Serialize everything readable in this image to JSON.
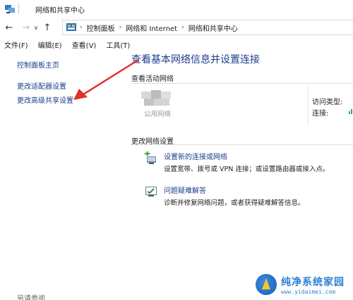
{
  "window": {
    "title": "网络和共享中心"
  },
  "navigation": {
    "breadcrumbs": [
      "控制面板",
      "网络和 Internet",
      "网络和共享中心"
    ]
  },
  "menu": {
    "items": [
      "文件(F)",
      "编辑(E)",
      "查看(V)",
      "工具(T)"
    ]
  },
  "sidebar": {
    "links": [
      "控制面板主页",
      "更改适配器设置",
      "更改高级共享设置"
    ],
    "see_also": "另请参阅"
  },
  "main": {
    "title": "查看基本网络信息并设置连接",
    "active_networks_label": "查看活动网络",
    "network_name": "公用网络",
    "access_type_label": "访问类型:",
    "connections_label": "连接:",
    "change_settings_label": "更改网络设置",
    "tasks": [
      {
        "link": "设置新的连接或网络",
        "desc": "设置宽带、拨号或 VPN 连接；或设置路由器或接入点。",
        "icon": "new-connection-icon"
      },
      {
        "link": "问题疑难解答",
        "desc": "诊断并修复网络问题，或者获得疑难解答信息。",
        "icon": "troubleshoot-icon"
      }
    ]
  },
  "watermark": {
    "title": "纯净系统家园",
    "url": "www.yidaimei.com"
  },
  "colors": {
    "link": "#1a3e8a",
    "title": "#1c3d8f",
    "annotation_arrow": "#e0312b"
  }
}
